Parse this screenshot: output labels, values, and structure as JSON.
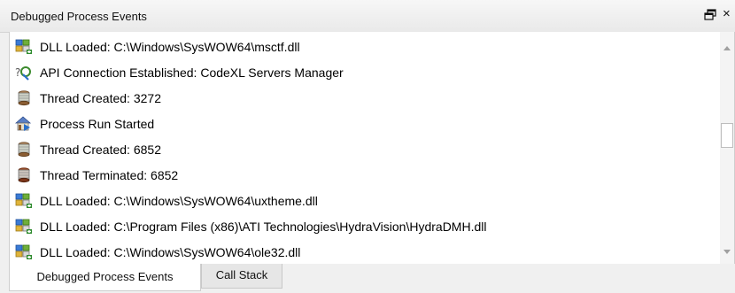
{
  "panel": {
    "title": "Debugged Process Events",
    "float_icon": "float-window-icon",
    "close_label": "×"
  },
  "events": [
    {
      "icon": "dll-module-icon",
      "text": "DLL Loaded: C:\\Windows\\SysWOW64\\msctf.dll"
    },
    {
      "icon": "api-connection-icon",
      "text": "API Connection Established: CodeXL Servers Manager"
    },
    {
      "icon": "thread-created-icon",
      "text": "Thread Created: 3272"
    },
    {
      "icon": "process-run-icon",
      "text": "Process Run Started"
    },
    {
      "icon": "thread-created-icon",
      "text": "Thread Created: 6852"
    },
    {
      "icon": "thread-terminated-icon",
      "text": "Thread Terminated: 6852"
    },
    {
      "icon": "dll-module-icon",
      "text": "DLL Loaded: C:\\Windows\\SysWOW64\\uxtheme.dll"
    },
    {
      "icon": "dll-module-icon",
      "text": "DLL Loaded: C:\\Program Files (x86)\\ATI Technologies\\HydraVision\\HydraDMH.dll"
    },
    {
      "icon": "dll-module-icon",
      "text": "DLL Loaded: C:\\Windows\\SysWOW64\\ole32.dll"
    }
  ],
  "tabs": [
    {
      "label": "Debugged Process Events",
      "active": true
    },
    {
      "label": "Call Stack",
      "active": false
    }
  ]
}
